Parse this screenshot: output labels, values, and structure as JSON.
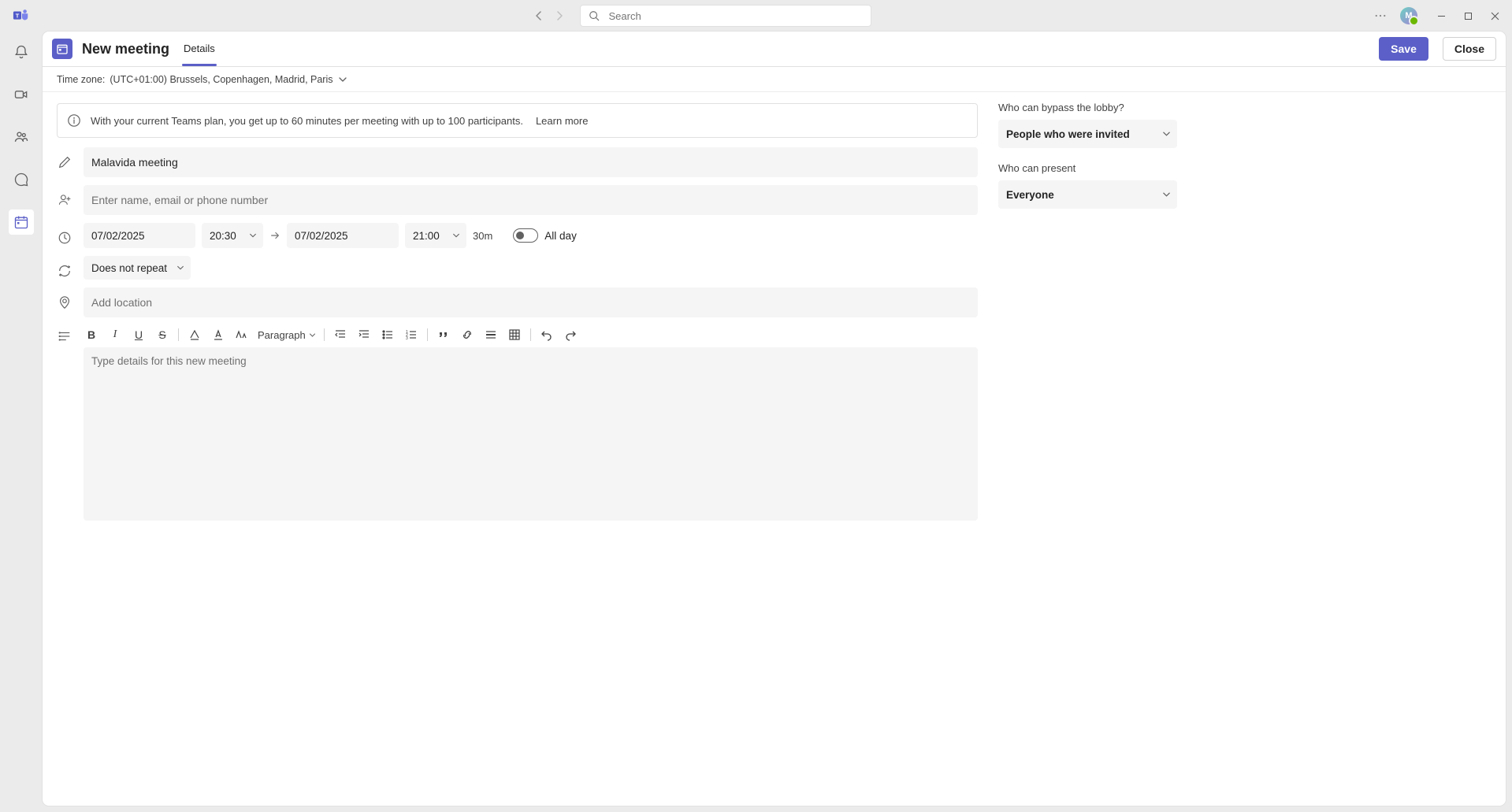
{
  "search_placeholder": "Search",
  "avatar_initial": "M",
  "header": {
    "title": "New meeting",
    "tab_details": "Details",
    "save": "Save",
    "close": "Close"
  },
  "timezone": {
    "prefix": "Time zone:",
    "value": "(UTC+01:00) Brussels, Copenhagen, Madrid, Paris"
  },
  "banner": {
    "text": "With your current Teams plan, you get up to 60 minutes per meeting with up to 100 participants.",
    "link": "Learn more"
  },
  "meeting_title": "Malavida meeting",
  "attendees_placeholder": "Enter name, email or phone number",
  "datetime": {
    "start_date": "07/02/2025",
    "start_time": "20:30",
    "end_date": "07/02/2025",
    "end_time": "21:00",
    "duration": "30m",
    "allday_label": "All day"
  },
  "recurrence": "Does not repeat",
  "location_placeholder": "Add location",
  "editor": {
    "paragraph_label": "Paragraph",
    "placeholder": "Type details for this new meeting"
  },
  "options": {
    "lobby_label": "Who can bypass the lobby?",
    "lobby_value": "People who were invited",
    "present_label": "Who can present",
    "present_value": "Everyone"
  }
}
